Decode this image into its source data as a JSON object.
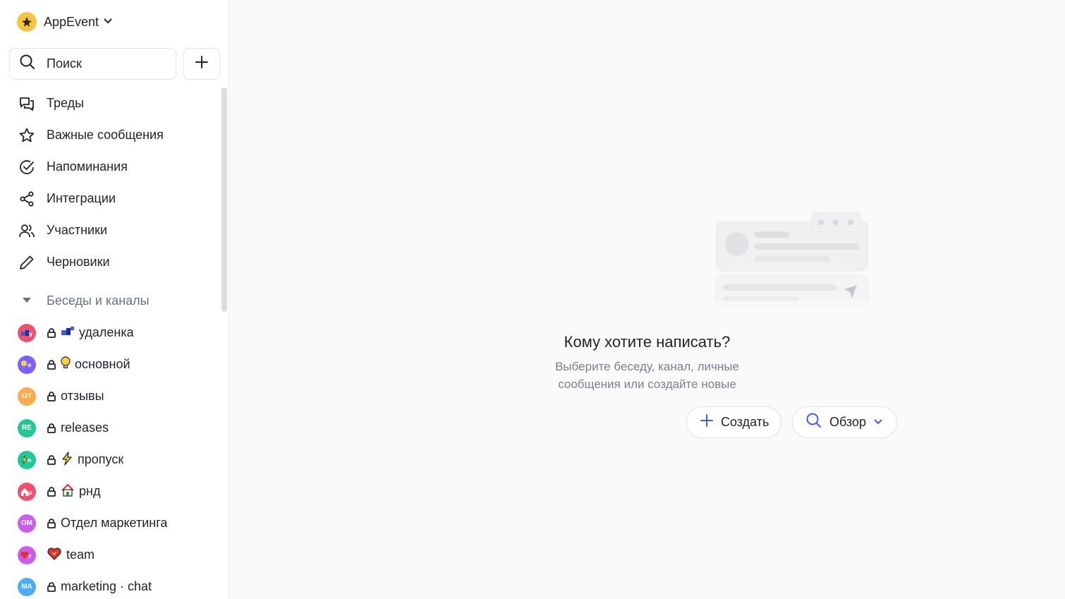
{
  "workspace": {
    "name": "AppEvent"
  },
  "sidebar": {
    "search_label": "Поиск",
    "nav": [
      {
        "label": "Треды",
        "icon": "threads-icon"
      },
      {
        "label": "Важные сообщения",
        "icon": "star-icon"
      },
      {
        "label": "Напоминания",
        "icon": "check-circle-icon"
      },
      {
        "label": "Интеграции",
        "icon": "share-nodes-icon"
      },
      {
        "label": "Участники",
        "icon": "users-icon"
      },
      {
        "label": "Черновики",
        "icon": "pencil-icon"
      }
    ],
    "section_label": "Беседы и каналы",
    "channels": [
      {
        "name": "удаленка",
        "emoji": "💤",
        "avatar_text": "💤у",
        "avatar_color": "#f0506e",
        "locked": true
      },
      {
        "name": "основной",
        "emoji": "💡",
        "avatar_text": "💡о",
        "avatar_color": "#7b61ff",
        "locked": true
      },
      {
        "name": "отзывы",
        "emoji": "",
        "avatar_text": "ОТ",
        "avatar_color": "#ffa94d",
        "locked": true
      },
      {
        "name": "releases",
        "emoji": "",
        "avatar_text": "RE",
        "avatar_color": "#20c997",
        "locked": true
      },
      {
        "name": "пропуск",
        "emoji": "⚡",
        "avatar_text": "⚡п",
        "avatar_color": "#20c997",
        "locked": true
      },
      {
        "name": "рнд",
        "emoji": "🏠",
        "avatar_text": "🏠р",
        "avatar_color": "#f0506e",
        "locked": true
      },
      {
        "name": "Отдел маркетинга",
        "emoji": "",
        "avatar_text": "ОМ",
        "avatar_color": "#cc5de8",
        "locked": true
      },
      {
        "name": "team",
        "emoji": "❤️",
        "avatar_text": "❤т",
        "avatar_color": "#cc5de8",
        "locked": false
      },
      {
        "name": "marketing · chat",
        "emoji": "",
        "avatar_text": "MA",
        "avatar_color": "#4dabf7",
        "locked": true
      }
    ]
  },
  "main": {
    "empty_title": "Кому хотите написать?",
    "empty_sub_line1": "Выберите беседу, канал, личные",
    "empty_sub_line2": "сообщения или создайте новые",
    "create_label": "Создать",
    "browse_label": "Обзор"
  },
  "colors": {
    "accent": "#3d5afe",
    "text": "#1f2329",
    "muted": "#7c8088"
  }
}
